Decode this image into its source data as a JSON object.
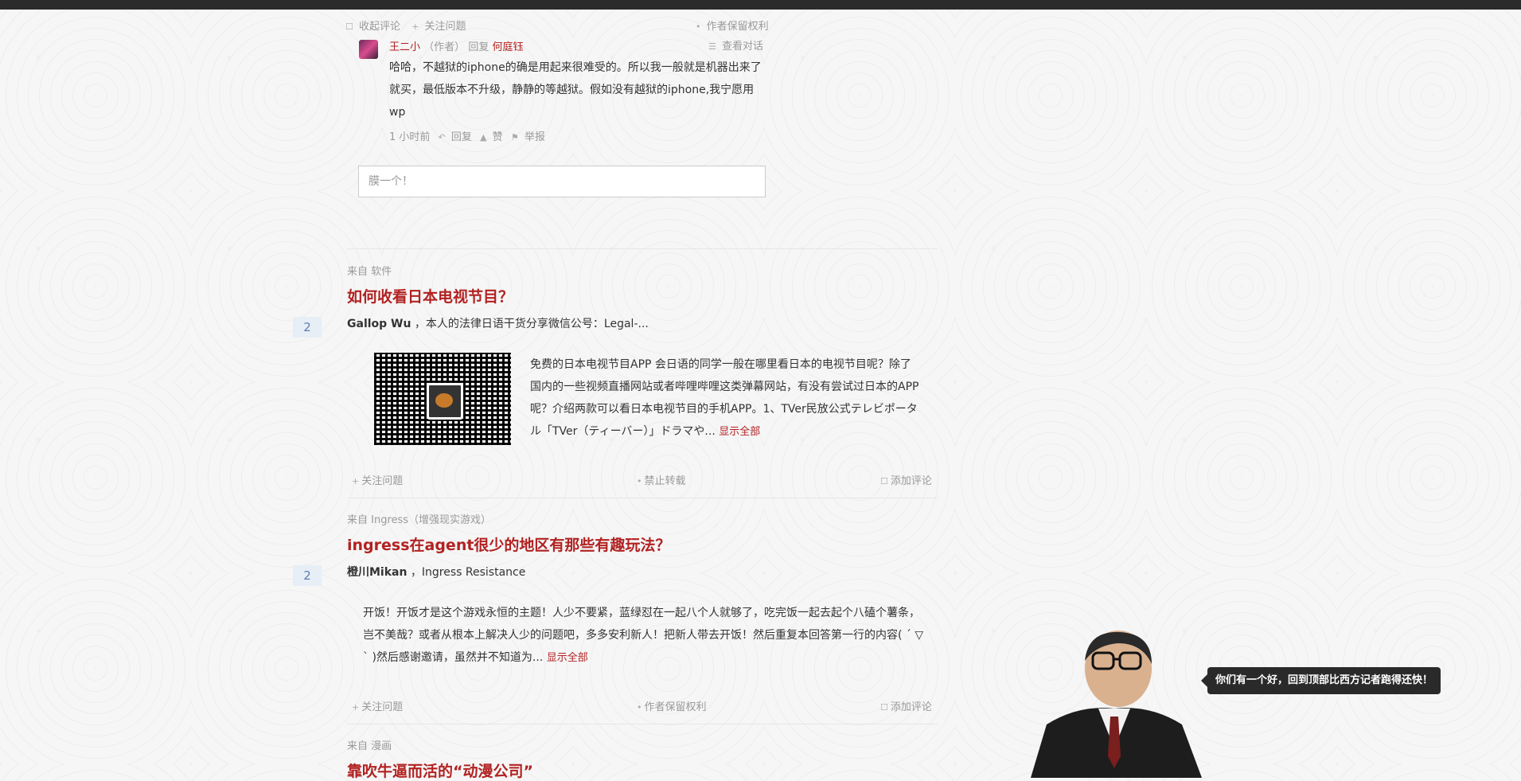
{
  "top_comment": {
    "actions_left": [
      "收起评论",
      "关注问题"
    ],
    "actions_right": "作者保留权利",
    "reply": {
      "author": "王二小",
      "author_tag": "（作者）",
      "reply_word": "回复",
      "reply_to": "何庭钰",
      "view_conversation": "查看对话",
      "lines": [
        "哈哈，不越狱的iphone的确是用起来很难受的。所以我一般就是机器出来了",
        "就买，最低版本不升级，静静的等越狱。假如没有越狱的iphone,我宁愿用",
        "wp"
      ],
      "time": "1 小时前",
      "reply_action": "回复",
      "like_action": "赞",
      "report_action": "举报"
    },
    "input_placeholder": "膜一个！"
  },
  "items": [
    {
      "source": "来自 软件",
      "title": "如何收看日本电视节目？",
      "votes": "2",
      "author": "Gallop Wu",
      "author_bio": "，本人的法律日语干货分享微信公号：Legal-...",
      "excerpt_lines": [
        "免费的日本电视节目APP 会日语的同学一般在哪里看日本的电视节目呢？除了",
        "国内的一些视频直播网站或者哔哩哔哩这类弹幕网站，有没有尝试过日本的APP",
        "呢？介绍两款可以看日本电视节目的手机APP。1、TVer民放公式テレビポータ",
        "ル「TVer（ティーバー）」ドラマや..."
      ],
      "show_all": "显示全部",
      "action_follow": "关注问题",
      "action_middle": "禁止转载",
      "action_comment": "添加评论"
    },
    {
      "source": "来自 Ingress（增强现实游戏）",
      "title": "ingress在agent很少的地区有那些有趣玩法？",
      "votes": "2",
      "author": "橙川Mikan",
      "author_bio": "，Ingress Resistance",
      "excerpt_lines": [
        "开饭！开饭才是这个游戏永恒的主题！人少不要紧，蓝绿怼在一起八个人就够了，吃完饭一起去起个八磕个薯条，",
        "岂不美哉？或者从根本上解决人少的问题吧，多多安利新人！把新人带去开饭！然后重复本回答第一行的内容( ´ ▽",
        "` )然后感谢邀请，虽然并不知道为..."
      ],
      "show_all": "显示全部",
      "action_follow": "关注问题",
      "action_middle": "作者保留权利",
      "action_comment": "添加评论"
    },
    {
      "source": "来自 漫画",
      "title": "靠吹牛逼而活的“动漫公司”"
    }
  ],
  "tooltip": "你们有一个好，回到顶部比西方记者跑得还快！",
  "colors": {
    "accent": "#b22222",
    "vote_bg": "#e8eef6",
    "topbar": "#2b2b2b"
  }
}
